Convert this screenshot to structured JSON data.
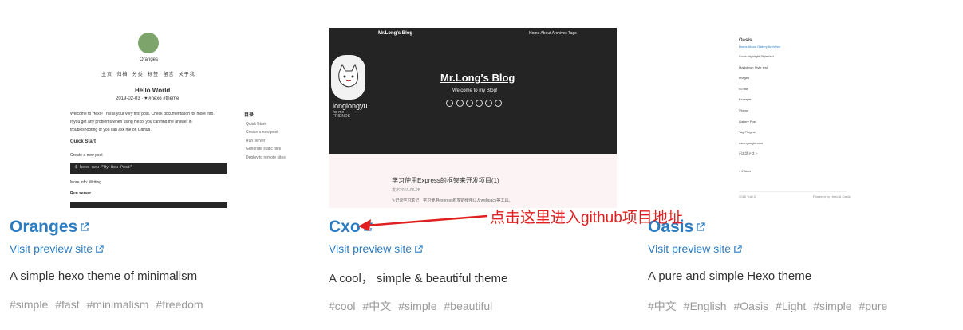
{
  "themes": [
    {
      "name": "Oranges",
      "preview_label": "Visit preview site",
      "description": "A simple hexo theme of minimalism",
      "tags": [
        "#simple",
        "#fast",
        "#minimalism",
        "#freedom"
      ],
      "thumbnail": {
        "blog_name": "Oranges",
        "nav": [
          "主页",
          "归档",
          "分类",
          "标签",
          "留言",
          "关于我"
        ],
        "post_title": "Hello World",
        "post_meta": "2019-02-03  ·  ♥ #hexo #theme",
        "body_lines": [
          "Welcome to Hexo! This is your very first post. Check documentation for more info.",
          "If you get any problems when using Hexo, you can find the answer in",
          "troubleshooting or you can ask me on GitHub."
        ],
        "quick_start": "Quick Start",
        "create_post": "Create a new post",
        "code": "$ hexo new \"My New Post\"",
        "more_info": "More info: Writing",
        "run_server": "Run server",
        "toc_title": "目录",
        "toc": [
          "Quick Start",
          "Create a new post",
          "Run server",
          "Generate static files",
          "Deploy to remote sites"
        ]
      }
    },
    {
      "name": "Cxo",
      "preview_label": "Visit preview site",
      "description": "A cool， simple & beautiful theme",
      "tags": [
        "#cool",
        "#中文",
        "#simple",
        "#beautiful"
      ],
      "thumbnail": {
        "top_title": "Mr.Long's Blog",
        "top_nav": "Home  About  Archives  Tags",
        "hero_title": "Mr.Long's Blog",
        "hero_sub": "Welcome to my Blog!",
        "user": "longlongyu",
        "user_sub1": "for me",
        "user_sub2": "FRIENDS",
        "post_title": "学习使用Express的框架来开发项目(1)",
        "post_date": "发布2018-06-28",
        "post_excerpt": "✎记录学习笔记，学习使用express框架的使用以及webpack等工具。"
      }
    },
    {
      "name": "Oasis",
      "preview_label": "Visit preview site",
      "description": "A pure and simple Hexo theme",
      "tags": [
        "#中文",
        "#English",
        "#Oasis",
        "#Light",
        "#simple",
        "#pure"
      ],
      "thumbnail": {
        "site": "Oasis",
        "nav": "Home  About  Gallery  Archives",
        "posts": [
          "Code Highlight Style test",
          "Markdown Style test",
          "Images",
          "no title",
          "Excerpts",
          "Videos",
          "Gallery Post",
          "Tag Plugins",
          "www.google.com",
          "日本語テスト"
        ],
        "pager": "1  2  Next",
        "footer_left": "2018 Yuki Z.",
        "footer_right": "Powered by Hexo & Oasis"
      }
    }
  ],
  "annotation": "点击这里进入github项目地址",
  "colors": {
    "link": "#2c7cc2",
    "tag": "#999999",
    "annotation": "#e02020"
  }
}
